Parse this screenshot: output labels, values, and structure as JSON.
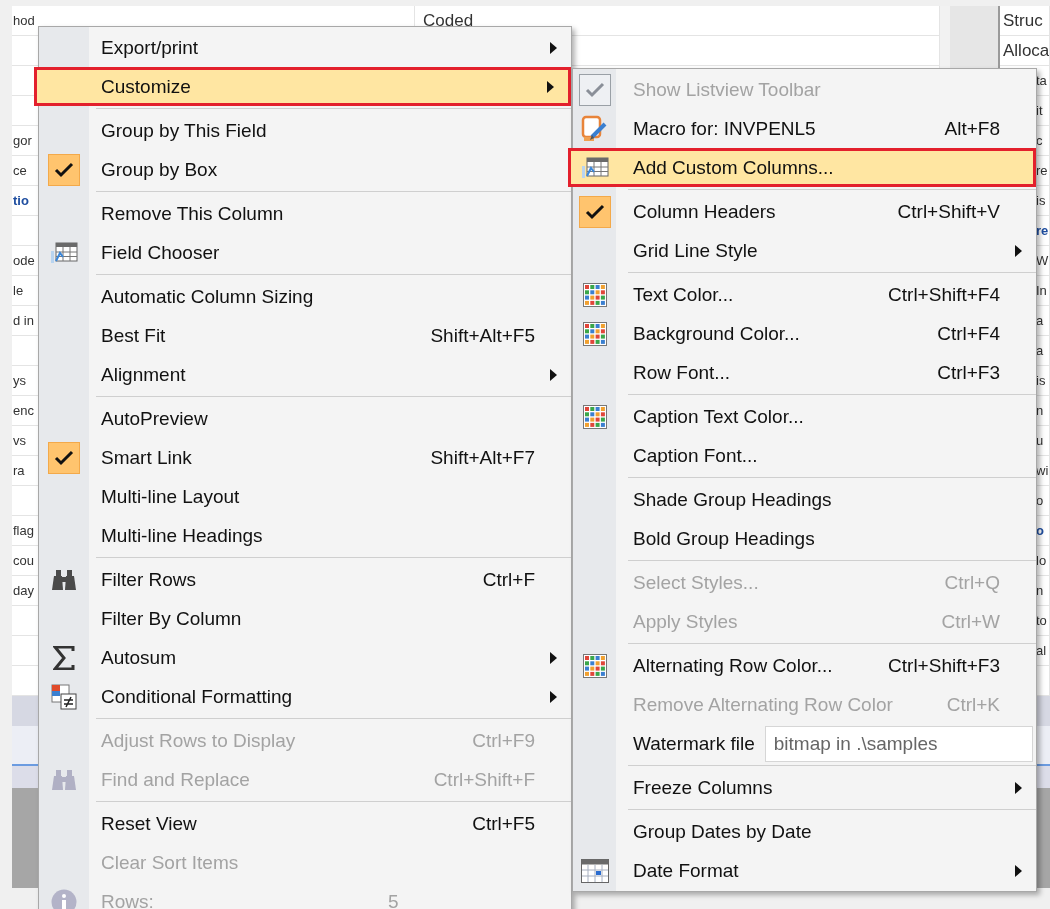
{
  "background_grid": {
    "rows": [
      {
        "column_1": {
          "text": "hod",
          "bold": false
        },
        "column_2": {
          "text": "Coded",
          "bold": false
        },
        "column_4": {
          "text": "Struc",
          "bold": false
        }
      },
      {
        "column_4": {
          "text": "Alloca",
          "bold": false
        }
      },
      {
        "column_4": {
          "text": "ta",
          "bold": false
        }
      },
      {
        "column_4": {
          "text": "it",
          "bold": false
        }
      },
      {
        "column_1": {
          "text": "gor",
          "bold": false
        },
        "column_4": {
          "text": "c",
          "bold": false
        }
      },
      {
        "column_1": {
          "text": "ce",
          "bold": false
        },
        "column_4": {
          "text": "re",
          "bold": false
        }
      },
      {
        "column_1": {
          "text": "tio",
          "bold": true
        },
        "column_4": {
          "text": "is",
          "bold": false
        }
      },
      {
        "column_4": {
          "text": "re",
          "bold": true
        }
      },
      {
        "column_1": {
          "text": "ode",
          "bold": false
        },
        "column_4": {
          "text": "W",
          "bold": false
        }
      },
      {
        "column_1": {
          "text": "le",
          "bold": false
        },
        "column_4": {
          "text": "In",
          "bold": false
        }
      },
      {
        "column_1": {
          "text": "d in",
          "bold": false
        },
        "column_4": {
          "text": "a",
          "bold": false
        }
      },
      {
        "column_4": {
          "text": "a",
          "bold": false
        }
      },
      {
        "column_1": {
          "text": "ys",
          "bold": false
        },
        "column_4": {
          "text": "is",
          "bold": false
        }
      },
      {
        "column_1": {
          "text": "enc",
          "bold": false
        },
        "column_4": {
          "text": "n",
          "bold": false
        }
      },
      {
        "column_1": {
          "text": "vs",
          "bold": false
        },
        "column_4": {
          "text": "u",
          "bold": false
        }
      },
      {
        "column_1": {
          "text": "ra",
          "bold": false
        },
        "column_4": {
          "text": "wi",
          "bold": false
        }
      },
      {
        "column_4": {
          "text": "o",
          "bold": false
        }
      },
      {
        "column_1": {
          "text": "flag",
          "bold": false
        },
        "column_4": {
          "text": "o",
          "bold": true
        }
      },
      {
        "column_1": {
          "text": "cou",
          "bold": false
        },
        "column_4": {
          "text": "lo",
          "bold": false
        }
      },
      {
        "column_1": {
          "text": "day",
          "bold": false
        },
        "column_4": {
          "text": "n",
          "bold": false
        }
      },
      {
        "column_4": {
          "text": "to",
          "bold": false
        }
      },
      {
        "column_4": {
          "text": "al",
          "bold": false
        }
      },
      {}
    ]
  },
  "context_menu": {
    "items": [
      {
        "kind": "item",
        "label": "Export/print",
        "checked": false,
        "disabled": false,
        "highlighted": false,
        "submenu": true
      },
      {
        "kind": "item",
        "label": "Customize",
        "checked": false,
        "disabled": false,
        "highlighted": true,
        "submenu": true
      },
      {
        "kind": "separator"
      },
      {
        "kind": "item",
        "label": "Group by This Field",
        "checked": false,
        "disabled": false,
        "highlighted": false,
        "submenu": false
      },
      {
        "kind": "item",
        "label": "Group by Box",
        "checked": true,
        "disabled": false,
        "highlighted": false,
        "submenu": false
      },
      {
        "kind": "separator"
      },
      {
        "kind": "item",
        "label": "Remove This Column",
        "checked": false,
        "disabled": false,
        "highlighted": false,
        "submenu": false
      },
      {
        "kind": "item",
        "label": "Field Chooser",
        "checked": false,
        "disabled": false,
        "highlighted": false,
        "submenu": false
      },
      {
        "kind": "separator"
      },
      {
        "kind": "item",
        "label": "Automatic Column Sizing",
        "checked": false,
        "disabled": false,
        "highlighted": false,
        "submenu": false
      },
      {
        "kind": "item",
        "label": "Best Fit",
        "shortcut": "Shift+Alt+F5",
        "checked": false,
        "disabled": false,
        "highlighted": false,
        "submenu": false
      },
      {
        "kind": "item",
        "label": "Alignment",
        "checked": false,
        "disabled": false,
        "highlighted": false,
        "submenu": true
      },
      {
        "kind": "separator"
      },
      {
        "kind": "item",
        "label": "AutoPreview",
        "checked": false,
        "disabled": false,
        "highlighted": false,
        "submenu": false
      },
      {
        "kind": "item",
        "label": "Smart Link",
        "shortcut": "Shift+Alt+F7",
        "checked": true,
        "disabled": false,
        "highlighted": false,
        "submenu": false
      },
      {
        "kind": "item",
        "label": "Multi-line Layout",
        "checked": false,
        "disabled": false,
        "highlighted": false,
        "submenu": false
      },
      {
        "kind": "item",
        "label": "Multi-line Headings",
        "checked": false,
        "disabled": false,
        "highlighted": false,
        "submenu": false
      },
      {
        "kind": "separator"
      },
      {
        "kind": "item",
        "label": "Filter Rows",
        "shortcut": "Ctrl+F",
        "checked": false,
        "disabled": false,
        "highlighted": false,
        "submenu": false
      },
      {
        "kind": "item",
        "label": "Filter By Column",
        "checked": false,
        "disabled": false,
        "highlighted": false,
        "submenu": false
      },
      {
        "kind": "item",
        "label": "Autosum",
        "checked": false,
        "disabled": false,
        "highlighted": false,
        "submenu": true
      },
      {
        "kind": "item",
        "label": "Conditional Formatting",
        "checked": false,
        "disabled": false,
        "highlighted": false,
        "submenu": true
      },
      {
        "kind": "separator"
      },
      {
        "kind": "item",
        "label": "Adjust Rows to Display",
        "shortcut": "Ctrl+F9",
        "checked": false,
        "disabled": true,
        "highlighted": false,
        "submenu": false
      },
      {
        "kind": "item",
        "label": "Find and Replace",
        "shortcut": "Ctrl+Shift+F",
        "checked": false,
        "disabled": true,
        "highlighted": false,
        "submenu": false
      },
      {
        "kind": "separator"
      },
      {
        "kind": "item",
        "label": "Reset View",
        "shortcut": "Ctrl+F5",
        "checked": false,
        "disabled": false,
        "highlighted": false,
        "submenu": false
      },
      {
        "kind": "item",
        "label": "Clear Sort Items",
        "checked": false,
        "disabled": true,
        "highlighted": false,
        "submenu": false
      },
      {
        "kind": "info",
        "label": "Rows:",
        "value": "5",
        "disabled": true
      }
    ]
  },
  "customize_submenu": {
    "items": [
      {
        "kind": "item",
        "label": "Show Listview Toolbar",
        "checked": true,
        "disabled": true,
        "highlighted": false,
        "submenu": false
      },
      {
        "kind": "item",
        "label": "Macro for: INVPENL5",
        "shortcut": "Alt+F8",
        "checked": false,
        "disabled": false,
        "highlighted": false,
        "submenu": false
      },
      {
        "kind": "item",
        "label": "Add Custom Columns...",
        "checked": false,
        "disabled": false,
        "highlighted": true,
        "submenu": false
      },
      {
        "kind": "separator"
      },
      {
        "kind": "item",
        "label": "Column Headers",
        "shortcut": "Ctrl+Shift+V",
        "checked": true,
        "disabled": false,
        "highlighted": false,
        "submenu": false
      },
      {
        "kind": "item",
        "label": "Grid Line Style",
        "checked": false,
        "disabled": false,
        "highlighted": false,
        "submenu": true
      },
      {
        "kind": "separator"
      },
      {
        "kind": "item",
        "label": "Text Color...",
        "shortcut": "Ctrl+Shift+F4",
        "checked": false,
        "disabled": false,
        "highlighted": false,
        "submenu": false
      },
      {
        "kind": "item",
        "label": "Background Color...",
        "shortcut": "Ctrl+F4",
        "checked": false,
        "disabled": false,
        "highlighted": false,
        "submenu": false
      },
      {
        "kind": "item",
        "label": "Row Font...",
        "shortcut": "Ctrl+F3",
        "checked": false,
        "disabled": false,
        "highlighted": false,
        "submenu": false
      },
      {
        "kind": "separator"
      },
      {
        "kind": "item",
        "label": "Caption Text Color...",
        "checked": false,
        "disabled": false,
        "highlighted": false,
        "submenu": false
      },
      {
        "kind": "item",
        "label": "Caption Font...",
        "checked": false,
        "disabled": false,
        "highlighted": false,
        "submenu": false
      },
      {
        "kind": "separator"
      },
      {
        "kind": "item",
        "label": "Shade Group Headings",
        "checked": false,
        "disabled": false,
        "highlighted": false,
        "submenu": false
      },
      {
        "kind": "item",
        "label": "Bold Group Headings",
        "checked": false,
        "disabled": false,
        "highlighted": false,
        "submenu": false
      },
      {
        "kind": "separator"
      },
      {
        "kind": "item",
        "label": "Select Styles...",
        "shortcut": "Ctrl+Q",
        "checked": false,
        "disabled": true,
        "highlighted": false,
        "submenu": false
      },
      {
        "kind": "item",
        "label": "Apply Styles",
        "shortcut": "Ctrl+W",
        "checked": false,
        "disabled": true,
        "highlighted": false,
        "submenu": false
      },
      {
        "kind": "separator"
      },
      {
        "kind": "item",
        "label": "Alternating Row Color...",
        "shortcut": "Ctrl+Shift+F3",
        "checked": false,
        "disabled": false,
        "highlighted": false,
        "submenu": false
      },
      {
        "kind": "item",
        "label": "Remove Alternating Row Color",
        "shortcut": "Ctrl+K",
        "checked": false,
        "disabled": true,
        "highlighted": false,
        "submenu": false
      },
      {
        "kind": "field",
        "label": "Watermark file",
        "value": "bitmap in .\\samples"
      },
      {
        "kind": "separator"
      },
      {
        "kind": "item",
        "label": "Freeze Columns",
        "checked": false,
        "disabled": false,
        "highlighted": false,
        "submenu": true
      },
      {
        "kind": "separator"
      },
      {
        "kind": "item",
        "label": "Group Dates by Date",
        "checked": false,
        "disabled": false,
        "highlighted": false,
        "submenu": false
      },
      {
        "kind": "item",
        "label": "Date Format",
        "checked": false,
        "disabled": false,
        "highlighted": false,
        "submenu": true
      }
    ]
  }
}
